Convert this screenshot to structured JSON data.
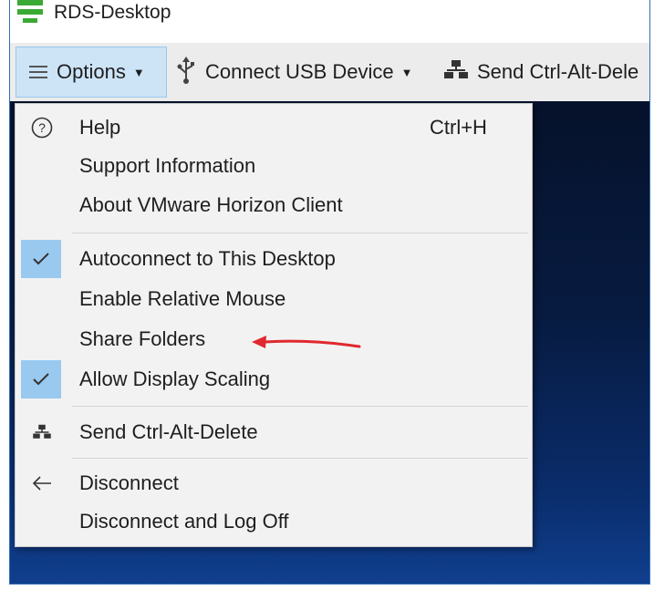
{
  "window": {
    "title": "RDS-Desktop"
  },
  "toolbar": {
    "options_label": "Options",
    "usb_label": "Connect USB Device",
    "cad_label": "Send Ctrl-Alt-Dele"
  },
  "menu": {
    "help": {
      "label": "Help",
      "shortcut": "Ctrl+H"
    },
    "support": "Support Information",
    "about": "About VMware Horizon Client",
    "autoconnect": {
      "label": "Autoconnect to This Desktop",
      "checked": true
    },
    "relative_mouse": "Enable Relative Mouse",
    "share_folders": "Share Folders",
    "display_scaling": {
      "label": "Allow Display Scaling",
      "checked": true
    },
    "send_cad": "Send Ctrl-Alt-Delete",
    "disconnect": "Disconnect",
    "disconnect_logoff": "Disconnect and Log Off"
  },
  "colors": {
    "arrow": "#e0282e",
    "app_icon": "#3aaa35",
    "check_highlight": "#99c9ef",
    "options_highlight": "#cde4f7"
  }
}
